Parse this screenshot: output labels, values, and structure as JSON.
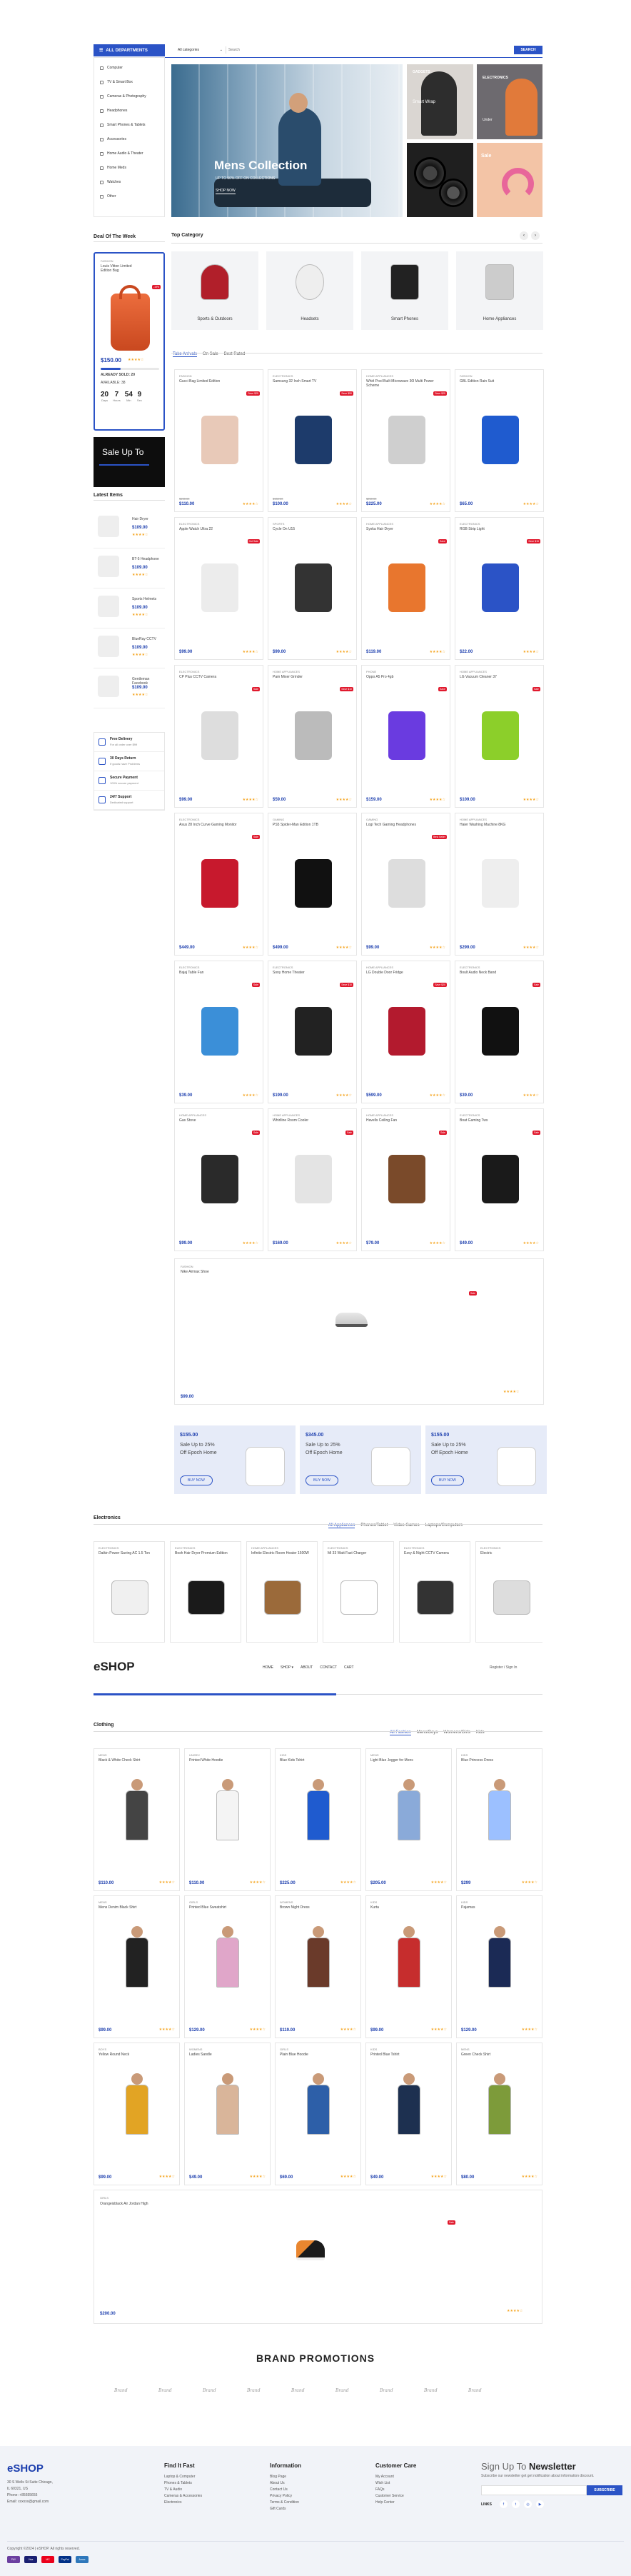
{
  "header": {
    "departments_label": "ALL DEPARTMENTS",
    "category_select": "All categories",
    "search_placeholder": "Search",
    "search_button": "SEARCH"
  },
  "sidebar": {
    "items": [
      "Computer",
      "TV & Smart Box",
      "Cameras & Photography",
      "Headphones",
      "Smart Phones & Tablets",
      "Accessories",
      "Home Audio & Theater",
      "Home Meds",
      "Watches",
      "Other"
    ]
  },
  "hero": {
    "title": "Mens Collection",
    "subtitle": "UP TO 50% OFF ON COLLECTIONS",
    "button": "SHOP NOW",
    "side1": "GADGETS",
    "side1_sub": "Smart Wrap",
    "side2": "ELECTRONICS",
    "side2_sub": "Under",
    "side3": "Sale"
  },
  "deal": {
    "title": "Deal Of The Week",
    "brand": "FASHION",
    "name": "Louis Vitton Limited Edition Bag",
    "price": "$150.00",
    "badge": "-19%",
    "already_sold": "ALREADY SOLD: 20",
    "available": "AVAILABLE: 38",
    "timer": [
      {
        "v": "20",
        "l": "Days"
      },
      {
        "v": "7",
        "l": "Hours"
      },
      {
        "v": "54",
        "l": "Min"
      },
      {
        "v": "9",
        "l": "Sec"
      }
    ],
    "promo": "Sale Up To"
  },
  "top_category": {
    "title": "Top Category",
    "items": [
      "Sports & Outdoors",
      "Headsets",
      "Smart Phones",
      "Home Appliances"
    ]
  },
  "product_tabs": [
    "Take Arrivals",
    "On Sale",
    "Best Rated"
  ],
  "products": [
    {
      "cat": "FASHION",
      "name": "Gucci Bag Limited Edition",
      "price": "$110.00",
      "old": "$135.00",
      "badge": "Save $25",
      "icon": "bag"
    },
    {
      "cat": "ELECTRONICS",
      "name": "Samsung 32 Inch Smart TV",
      "price": "$100.00",
      "old": "$150.00",
      "badge": "Save $50",
      "icon": "tv"
    },
    {
      "cat": "HOME APPLIANCES",
      "name": "Whirl Pool Built Microwave 30l Multi Power Scheme",
      "price": "$225.00",
      "old": "$250.00",
      "badge": "Save $25",
      "icon": "microwave"
    },
    {
      "cat": "FASHION",
      "name": "GBL Edition Rain Suit",
      "price": "$65.00",
      "old": "",
      "badge": "",
      "icon": "jacket"
    },
    {
      "cat": "ELECTRONICS",
      "name": "Apple Watch Ultra 22",
      "price": "$99.00",
      "old": "",
      "badge": "Hot Sale",
      "icon": "watch"
    },
    {
      "cat": "SPORTS",
      "name": "Cycle On U15",
      "price": "$99.00",
      "old": "",
      "badge": "",
      "icon": "bike"
    },
    {
      "cat": "HOME APPLIANCES",
      "name": "Syska Hair Dryer",
      "price": "$119.00",
      "old": "",
      "badge": "Save",
      "icon": "dryer"
    },
    {
      "cat": "ELECTRONICS",
      "name": "RGB Strip Light",
      "price": "$22.00",
      "old": "",
      "badge": "Save $15",
      "icon": "strip"
    },
    {
      "cat": "ELECTRONICS",
      "name": "CP Plus CCTV Camera",
      "price": "$99.00",
      "old": "",
      "badge": "Sale",
      "icon": "cctv"
    },
    {
      "cat": "HOME APPLIANCES",
      "name": "Pam Mixer Grinder",
      "price": "$59.00",
      "old": "",
      "badge": "Save $10",
      "icon": "mixer"
    },
    {
      "cat": "PHONE",
      "name": "Oppo A5 Pro 4gb",
      "price": "$159.00",
      "old": "",
      "badge": "Save",
      "icon": "phone"
    },
    {
      "cat": "HOME APPLIANCES",
      "name": "LG Vacuum Cleaner 37",
      "price": "$109.00",
      "old": "",
      "badge": "Sale",
      "icon": "vacuum"
    },
    {
      "cat": "ELECTRONICS",
      "name": "Asus 28 Inch Curve Gaming Monitor",
      "price": "$449.00",
      "old": "",
      "badge": "Sale",
      "icon": "monitor"
    },
    {
      "cat": "GAMING",
      "name": "PS5 Spider-Man Edition 1TB",
      "price": "$499.00",
      "old": "",
      "badge": "",
      "icon": "ps5"
    },
    {
      "cat": "GAMING",
      "name": "Logi Tech Gaming Headphones",
      "price": "$99.00",
      "old": "",
      "badge": "Best Seller",
      "icon": "headset"
    },
    {
      "cat": "HOME APPLIANCES",
      "name": "Haier Washing Machine 8KG",
      "price": "$299.00",
      "old": "",
      "badge": "",
      "icon": "washer"
    },
    {
      "cat": "ELECTRONICS",
      "name": "Bajaj Table Fan",
      "price": "$39.00",
      "old": "",
      "badge": "Sale",
      "icon": "fan"
    },
    {
      "cat": "ELECTRONICS",
      "name": "Sony Home Theater",
      "price": "$199.00",
      "old": "",
      "badge": "Save $10",
      "icon": "theater"
    },
    {
      "cat": "HOME APPLIANCES",
      "name": "LG Double Door Fridge",
      "price": "$599.00",
      "old": "",
      "badge": "Save $20",
      "icon": "fridge"
    },
    {
      "cat": "ELECTRONICS",
      "name": "Boult Audio Neck Band",
      "price": "$39.00",
      "old": "",
      "badge": "Sale",
      "icon": "neckband"
    },
    {
      "cat": "HOME APPLIANCES",
      "name": "Gas Stove",
      "price": "$99.00",
      "old": "",
      "badge": "Sale",
      "icon": "stove"
    },
    {
      "cat": "HOME APPLIANCES",
      "name": "Whirlline Room Cooler",
      "price": "$169.00",
      "old": "",
      "badge": "Sale",
      "icon": "cooler"
    },
    {
      "cat": "HOME APPLIANCES",
      "name": "Havells Ceiling Fan",
      "price": "$79.00",
      "old": "",
      "badge": "Sale",
      "icon": "ceilingfan"
    },
    {
      "cat": "ELECTRONICS",
      "name": "Boat Gaming Tws",
      "price": "$49.00",
      "old": "",
      "badge": "Sale",
      "icon": "tws"
    }
  ],
  "wide_product": {
    "cat": "FASHION",
    "name": "Nike Airmax Shoe",
    "price": "$99.00",
    "badge": "Sale"
  },
  "promos": [
    {
      "price": "$155.00",
      "line1": "Sale Up to 25%",
      "line2": "Off Epoch Home",
      "btn": "BUY NOW"
    },
    {
      "price": "$345.00",
      "line1": "Sale Up to 25%",
      "line2": "Off Epoch Home",
      "btn": "BUY NOW"
    },
    {
      "price": "$155.00",
      "line1": "Sale Up to 25%",
      "line2": "Off Epoch Home",
      "btn": "BUY NOW"
    }
  ],
  "electronics": {
    "title": "Electronics",
    "tabs": [
      "All Appliances",
      "Phones/Tablet",
      "Video Games",
      "Laptops/Computers"
    ],
    "items": [
      {
        "cat": "ELECTRONICS",
        "name": "Daikin Power Saving AC 1.5 Ton",
        "icon": "ac"
      },
      {
        "cat": "ELECTRONICS",
        "name": "Bosh Hair Dryer Premium Edition",
        "icon": "dryer2"
      },
      {
        "cat": "HOME APPLIANCES",
        "name": "Infinite Electric Room Heater 1500W",
        "icon": "heater"
      },
      {
        "cat": "ELECTRONICS",
        "name": "Mi 33 Watt Fast Charger",
        "icon": "charger"
      },
      {
        "cat": "ELECTRONICS",
        "name": "Ezvy & Night CCTV Camera",
        "icon": "cctv2"
      },
      {
        "cat": "ELECTRONICS",
        "name": "Electric",
        "icon": "misc"
      }
    ]
  },
  "mini_header": {
    "logo": "eSHOP",
    "links": [
      "HOME",
      "SHOP ▾",
      "ABOUT",
      "CONTACT",
      "CART"
    ],
    "auth": "Register / Sign In"
  },
  "clothing": {
    "title": "Clothing",
    "tabs": [
      "All Fashion",
      "Mens/Boys",
      "Womens/Girls",
      "Kids"
    ],
    "items": [
      {
        "cat": "MENS",
        "name": "Black & White Check Shirt",
        "price": "$110.00",
        "icon": "man1"
      },
      {
        "cat": "UNISEX",
        "name": "Printed White Hoodie",
        "price": "$110.00",
        "icon": "man2"
      },
      {
        "cat": "KIDS",
        "name": "Blue Kids Tshirt",
        "price": "$225.00",
        "icon": "kid1"
      },
      {
        "cat": "MENS",
        "name": "Light Blue Jogger for Mens",
        "price": "$205.00",
        "icon": "man3"
      },
      {
        "cat": "KIDS",
        "name": "Blue Princess Dress",
        "price": "$299",
        "icon": "girl1"
      },
      {
        "cat": "MENS",
        "name": "Mens Denim Black Shirt",
        "price": "$99.00",
        "icon": "man4"
      },
      {
        "cat": "GIRLS",
        "name": "Printed Blue Sweatshirt",
        "price": "$129.00",
        "icon": "girl2"
      },
      {
        "cat": "WOMENS",
        "name": "Brown Night Dress",
        "price": "$119.00",
        "icon": "woman1"
      },
      {
        "cat": "KIDS",
        "name": "Kurta",
        "price": "$99.00",
        "icon": "kid2"
      },
      {
        "cat": "KIDS",
        "name": "Pajamas",
        "price": "$129.00",
        "icon": "pajama"
      },
      {
        "cat": "BOYS",
        "name": "Yellow Round Neck",
        "price": "$99.00",
        "icon": "boy1"
      },
      {
        "cat": "WOMENS",
        "name": "Ladies Sandle",
        "price": "$49.00",
        "icon": "sandal"
      },
      {
        "cat": "GIRLS",
        "name": "Plain Blue Hoodie",
        "price": "$69.00",
        "icon": "girl3"
      },
      {
        "cat": "KIDS",
        "name": "Printed Blue Tshirt",
        "price": "$49.00",
        "icon": "kid3"
      },
      {
        "cat": "MENS",
        "name": "Green Check Shirt",
        "price": "$80.00",
        "icon": "man5"
      }
    ],
    "wide": {
      "cat": "GIRLS",
      "name": "Orangeisblack Air Jordan High",
      "price": "$200.00",
      "badge": "Sale"
    }
  },
  "latest": {
    "title": "Latest Items",
    "items": [
      {
        "name": "Hair Dryer",
        "price": "$109.00"
      },
      {
        "name": "BT-5 Headphone",
        "price": "$109.00"
      },
      {
        "name": "Sports Helmets",
        "price": "$109.00"
      },
      {
        "name": "BlueRay CCTV",
        "price": "$109.00"
      },
      {
        "name": "Gentleman Facebook",
        "price": "$109.00"
      }
    ]
  },
  "features": [
    {
      "title": "Free Delivery",
      "text": "For all order over $99"
    },
    {
      "title": "30 Days Return",
      "text": "If goods have Problems"
    },
    {
      "title": "Secure Payment",
      "text": "100% secure payment"
    },
    {
      "title": "24/7 Support",
      "text": "Dedicated support"
    }
  ],
  "brands_title": "BRAND PROMOTIONS",
  "brands": [
    "Brand",
    "Brand",
    "Brand",
    "Brand",
    "Brand",
    "Brand",
    "Brand",
    "Brand",
    "Brand"
  ],
  "footer": {
    "logo": "eSHOP",
    "address": [
      "30 S Wells St Suite Chicago,",
      "IL 60321, US"
    ],
    "phone": "Phone: +85655655",
    "email": "Email: xxxxxx@gmail.com",
    "col1_title": "Find It Fast",
    "col1": [
      "Laptop & Computer",
      "Phones & Tablets",
      "TV & Audio",
      "Cameras & Accessories",
      "Electronics"
    ],
    "col2_title": "Information",
    "col2": [
      "Blog Page",
      "About Us",
      "Contact Us",
      "Privacy Policy",
      "Terms & Condition",
      "Gift Cards"
    ],
    "col3_title": "Customer Care",
    "col3": [
      "My Account",
      "Wish List",
      "FAQs",
      "Customer Service",
      "Help Center"
    ],
    "newsletter_title_a": "Sign Up To ",
    "newsletter_title_b": "Newsletter",
    "newsletter_text": "Subscribe our newsletter get get notification about information discount.",
    "subscribe": "SUBSCRIBE",
    "links_label": "LINKS",
    "copyright": "Copyright ©2024 | eSHOP. All rights reserved.",
    "payments": [
      "PAY",
      "Visa",
      "MC",
      "PayPal",
      "Amex"
    ]
  }
}
